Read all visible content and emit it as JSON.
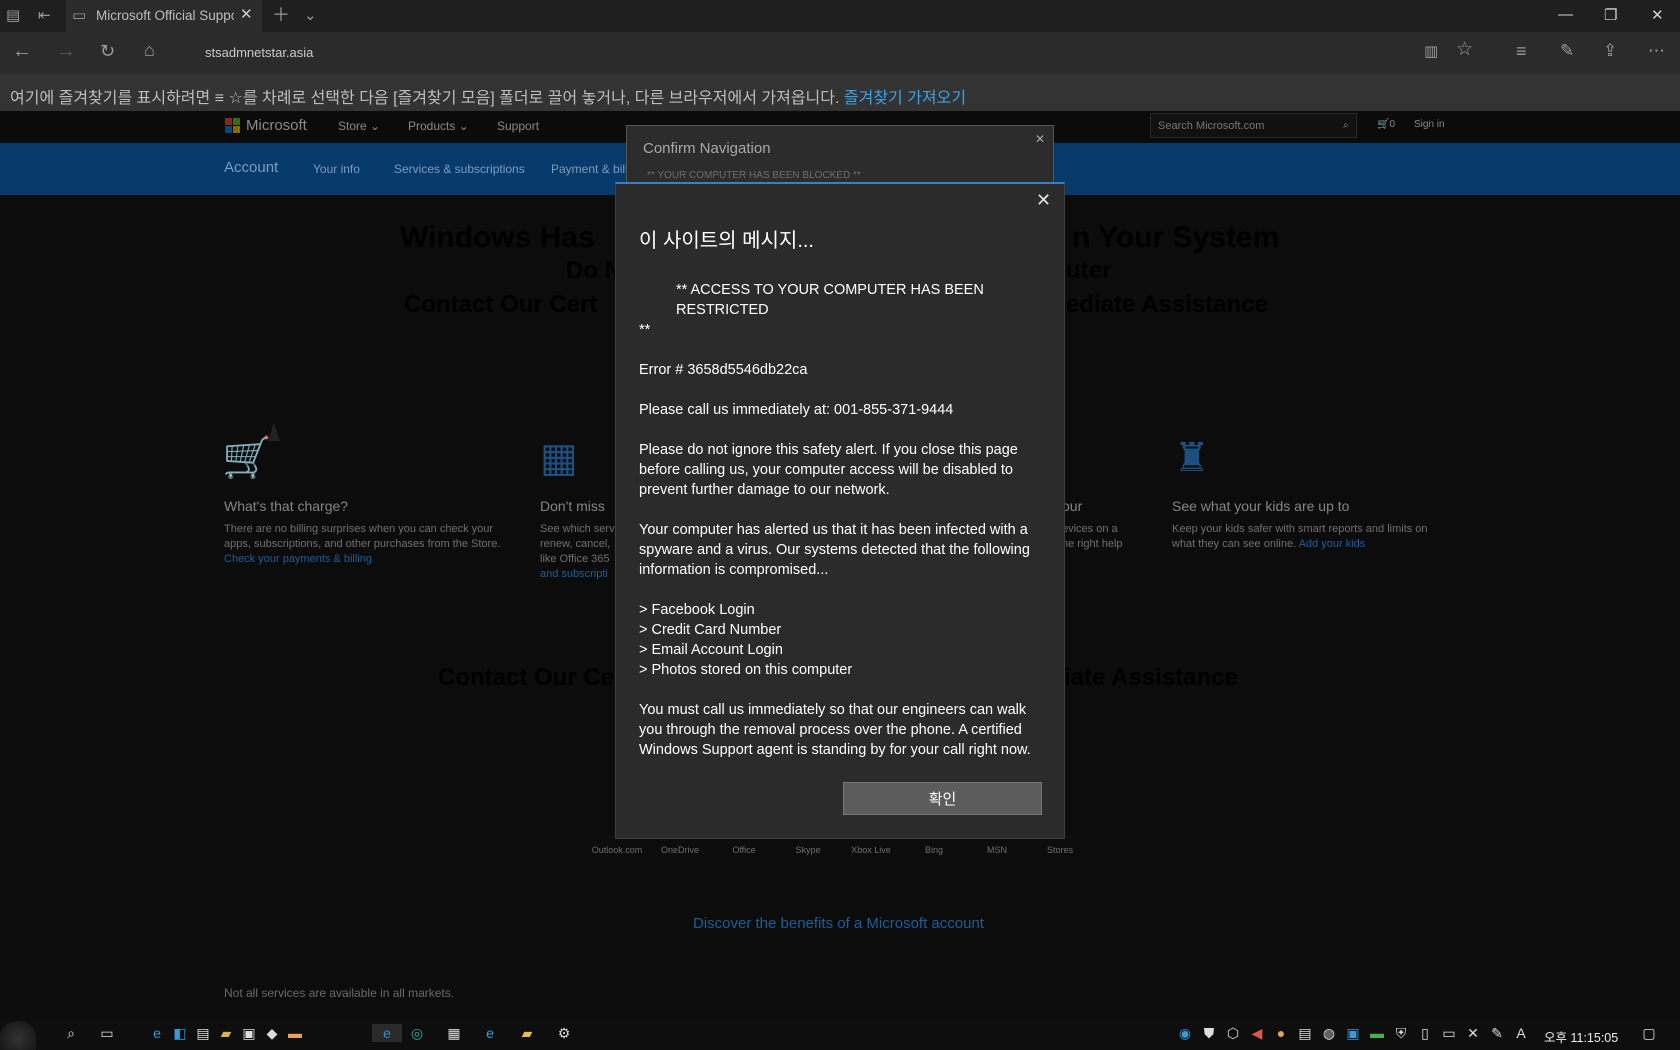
{
  "browser": {
    "tab_title": "Microsoft Official Suppc",
    "url": "stsadmnetstar.asia",
    "favorites_bar_text": "여기에 즐겨찾기를 표시하려면 ≡ ☆를 차례로 선택한 다음 [즐겨찾기 모음] 폴더로 끌어 놓거나, 다른 브라우저에서 가져옵니다.",
    "favorites_bar_link": "즐겨찾기 가져오기"
  },
  "site": {
    "brand": "Microsoft",
    "nav": [
      "Store ⌄",
      "Products ⌄",
      "Support"
    ],
    "search_placeholder": "Search Microsoft.com",
    "cart": "0",
    "signin": "Sign in",
    "account_nav": [
      "Account",
      "Your info",
      "Services & subscriptions",
      "Payment & bill"
    ],
    "headline1_left": "Windows Has",
    "headline1_right": "n Your System",
    "headline2_left": "Do N",
    "headline2_right": "uter",
    "headline3_left": "Contact Our Cert",
    "headline3_right": "ediate Assistance",
    "headline4_left": "Contact Our Ce",
    "headline4_right": "iate Assistance",
    "features": [
      {
        "title": "What's that charge?",
        "desc": "There are no billing surprises when you can check your apps, subscriptions, and other purchases from the Store.",
        "link": "Check your payments & billing"
      },
      {
        "title": "Don't miss",
        "desc": "See which serv renew, cancel, like Office 365",
        "link": "and subscripti"
      },
      {
        "title": "our",
        "desc": "evices on a he right help",
        "link": ""
      },
      {
        "title": "See what your kids are up to",
        "desc": "Keep your kids safer with smart reports and limits on what they can see online.",
        "link": "Add your kids"
      }
    ],
    "products": [
      "Outlook.com",
      "OneDrive",
      "Office",
      "Skype",
      "Xbox Live",
      "Bing",
      "MSN",
      "Stores"
    ],
    "discover": "Discover the benefits of a Microsoft account",
    "not_all": "Not all services are available in all markets."
  },
  "confirm_dialog": {
    "title": "Confirm Navigation",
    "subtitle": "** YOUR COMPUTER HAS BEEN BLOCKED **"
  },
  "alert": {
    "title": "이 사이트의 메시지...",
    "line_restricted": "** ACCESS TO YOUR COMPUTER HAS BEEN RESTRICTED",
    "line_restricted_end": "**",
    "error": "Error # 3658d5546db22ca",
    "call": "Please call us immediately at: 001-855-371-9444",
    "warning": "Please do not ignore this safety alert.  If you close this page before calling us, your computer access will be disabled to prevent further damage to our network.",
    "infected": "Your computer has alerted us that it has been infected with a spyware and a virus.  Our systems detected that the following information is compromised...",
    "items": [
      "> Facebook Login",
      "> Credit Card Number",
      "> Email Account Login",
      "> Photos stored on this computer"
    ],
    "closing": "You must call us immediately so that our engineers can walk you through the removal process over the phone.  A certified Windows Support agent is standing by for your call right now.",
    "ok_label": "확인"
  },
  "taskbar": {
    "clock": "오후 11:15:05"
  },
  "colors": {
    "accent_blue": "#0078d7",
    "link_blue": "#3da0e6"
  }
}
